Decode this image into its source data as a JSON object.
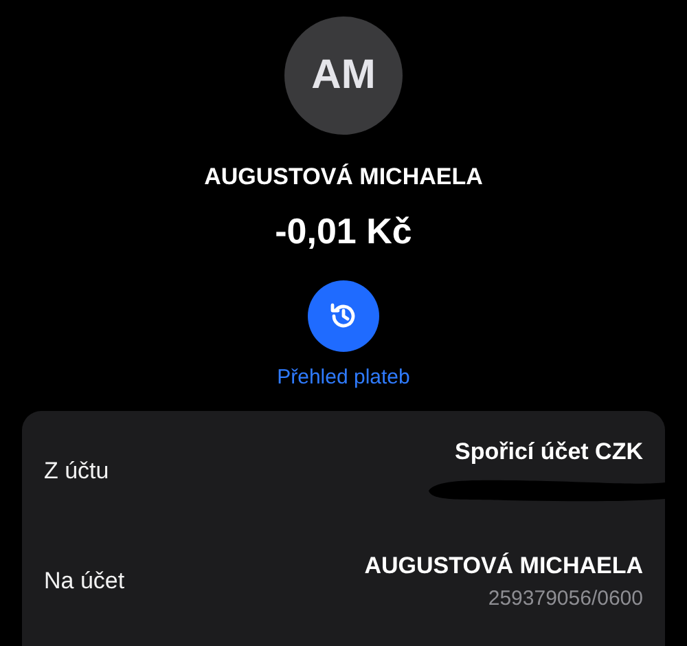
{
  "contact": {
    "initials": "AM",
    "name": "AUGUSTOVÁ MICHAELA",
    "amount": "-0,01 Kč"
  },
  "history_button": {
    "label": "Přehled plateb"
  },
  "details": [
    {
      "label": "Z účtu",
      "value": "Spořicí účet CZK",
      "redacted": true
    },
    {
      "label": "Na účet",
      "value": "AUGUSTOVÁ MICHAELA",
      "account": "259379056/0600",
      "redacted": false
    }
  ]
}
